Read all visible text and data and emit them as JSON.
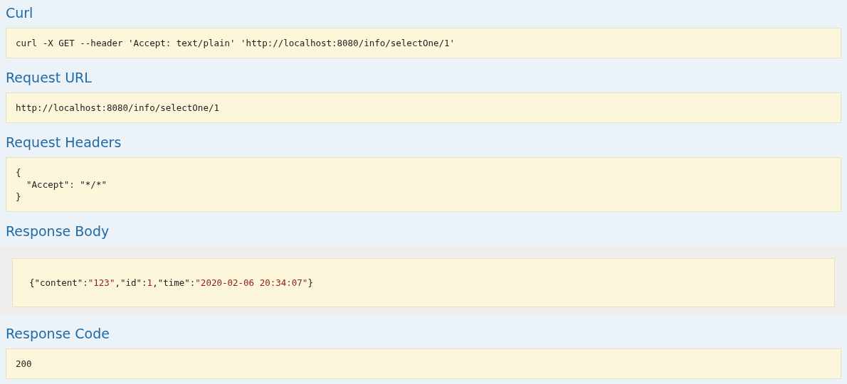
{
  "sections": [
    {
      "kind": "code",
      "heading": "Curl",
      "text": "curl -X GET --header 'Accept: text/plain' 'http://localhost:8080/info/selectOne/1'"
    },
    {
      "kind": "code",
      "heading": "Request URL",
      "text": "http://localhost:8080/info/selectOne/1"
    },
    {
      "kind": "code",
      "heading": "Request Headers",
      "text": "{\n  \"Accept\": \"*/*\"\n}"
    },
    {
      "kind": "body",
      "heading": "Response Body",
      "tokens": [
        {
          "kind": "punct",
          "text": "{\"content\":"
        },
        {
          "kind": "value",
          "text": "\"123\""
        },
        {
          "kind": "punct",
          "text": ",\"id\":"
        },
        {
          "kind": "value",
          "text": "1"
        },
        {
          "kind": "punct",
          "text": ",\"time\":"
        },
        {
          "kind": "value",
          "text": "\"2020-02-06 20:34:07\""
        },
        {
          "kind": "punct",
          "text": "}"
        }
      ]
    },
    {
      "kind": "code",
      "heading": "Response Code",
      "text": "200"
    }
  ]
}
